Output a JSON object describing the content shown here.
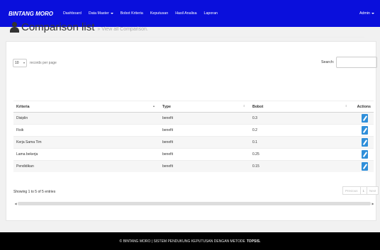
{
  "colors": {
    "navbar": "#0a0fdc",
    "footer": "#000000",
    "edit_button": "#2f8fda"
  },
  "navbar": {
    "brand": "BINTANG MORO",
    "items": [
      {
        "label": "Dashboard",
        "has_caret": false
      },
      {
        "label": "Data Master",
        "has_caret": true
      },
      {
        "label": "Bobot Kriteria",
        "has_caret": false
      },
      {
        "label": "Keputusan",
        "has_caret": false
      },
      {
        "label": "Hasil Analisa",
        "has_caret": false
      },
      {
        "label": "Laporan",
        "has_caret": false
      }
    ],
    "user_menu": "Admin"
  },
  "page": {
    "title": "Comparison list",
    "subtitle": "» View all Comparison.",
    "title_icon": "user-icon"
  },
  "table_controls": {
    "page_length": "10",
    "page_length_label": "records per page",
    "search_label": "Search:",
    "search_value": ""
  },
  "table": {
    "columns": [
      "Kriteria",
      "Type",
      "Bobot",
      "Actions"
    ],
    "sort_icons": [
      "sort-asc-icon",
      "sort-icon",
      "sort-icon"
    ],
    "rows": [
      {
        "kriteria": "Disiplin",
        "type": "benefit",
        "bobot": "0.3",
        "action_icon": "edit-icon"
      },
      {
        "kriteria": "Fisik",
        "type": "benefit",
        "bobot": "0.2",
        "action_icon": "edit-icon"
      },
      {
        "kriteria": "Kerja Sama Tim",
        "type": "benefit",
        "bobot": "0.1",
        "action_icon": "edit-icon"
      },
      {
        "kriteria": "Lama bekerja",
        "type": "benefit",
        "bobot": "0.25",
        "action_icon": "edit-icon"
      },
      {
        "kriteria": "Pendidikan",
        "type": "benefit",
        "bobot": "0.15",
        "action_icon": "edit-icon"
      }
    ]
  },
  "table_footer": {
    "info": "Showing 1 to 5 of 5 entries",
    "pagination": {
      "previous": "Previous",
      "current": "1",
      "next": "Next"
    }
  },
  "footer": {
    "text": "© BINTANG MORO | SISTEM PENDUKUNG KEPUTUSAN DENGAN METODE",
    "strong": "TOPSIS."
  }
}
